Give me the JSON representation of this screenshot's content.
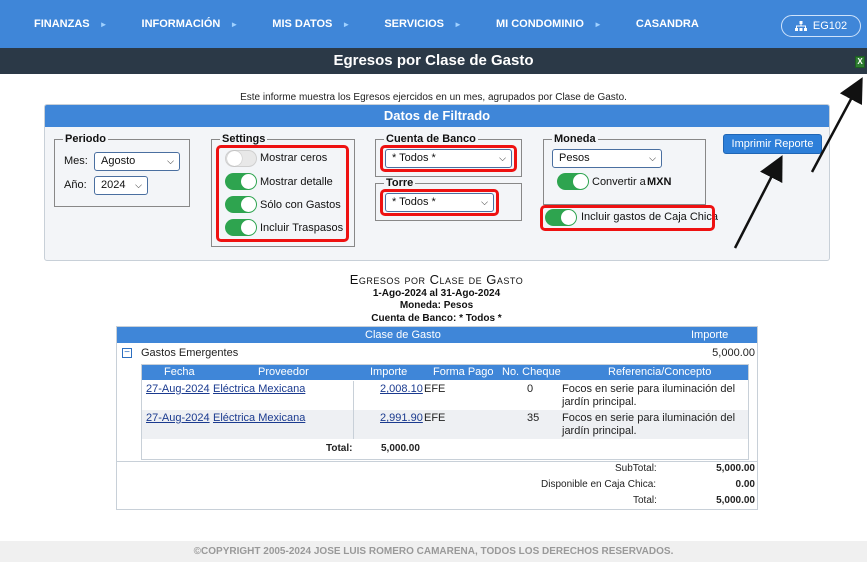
{
  "nav": {
    "items": [
      "FINANZAS",
      "INFORMACIÓN",
      "MIS DATOS",
      "SERVICIOS",
      "MI CONDOMINIO",
      "CASANDRA"
    ],
    "user_label": "EG102"
  },
  "page_title": "Egresos por Clase de Gasto",
  "intro_text": "Este informe muestra los Egresos ejercidos en un mes, agrupados por Clase de Gasto.",
  "filters": {
    "heading": "Datos de Filtrado",
    "periodo": {
      "legend": "Periodo",
      "mes_label": "Mes:",
      "mes_value": "Agosto",
      "anio_label": "Año:",
      "anio_value": "2024"
    },
    "settings": {
      "legend": "Settings",
      "toggles": [
        {
          "label": "Mostrar ceros",
          "on": false
        },
        {
          "label": "Mostrar detalle",
          "on": true
        },
        {
          "label": "Sólo con Gastos",
          "on": true
        },
        {
          "label": "Incluir Traspasos",
          "on": true
        }
      ]
    },
    "cuenta_banco": {
      "legend": "Cuenta de Banco",
      "value": "* Todos *"
    },
    "torre": {
      "legend": "Torre",
      "value": "* Todos *"
    },
    "moneda": {
      "legend": "Moneda",
      "value": "Pesos",
      "convertir_label": "Convertir a",
      "convertir_currency": "MXN",
      "caja_chica_label": "Incluir gastos de Caja Chica"
    },
    "print_label": "Imprimir Reporte"
  },
  "report": {
    "title": "Egresos por Clase de Gasto",
    "period": "1-Ago-2024 al 31-Ago-2024",
    "moneda_line": "Moneda: Pesos",
    "cuenta_line": "Cuenta de Banco: * Todos *",
    "col_clase": "Clase de Gasto",
    "col_importe": "Importe",
    "group": {
      "name": "Gastos Emergentes",
      "amount": "5,000.00"
    },
    "detail_headers": {
      "fecha": "Fecha",
      "proveedor": "Proveedor",
      "importe": "Importe",
      "forma_pago": "Forma Pago",
      "cheque": "No. Cheque",
      "referencia": "Referencia/Concepto"
    },
    "rows": [
      {
        "fecha": "27-Aug-2024",
        "proveedor": "Eléctrica Mexicana",
        "importe": "2,008.10",
        "forma_pago": "EFE",
        "cheque": "0",
        "ref1": "Focos en serie para iluminación del",
        "ref2": "jardín principal."
      },
      {
        "fecha": "27-Aug-2024",
        "proveedor": "Eléctrica Mexicana",
        "importe": "2,991.90",
        "forma_pago": "EFE",
        "cheque": "35",
        "ref1": "Focos en serie para iluminación del",
        "ref2": "jardín principal."
      }
    ],
    "detail_total_label": "Total:",
    "detail_total": "5,000.00",
    "subtotal_label": "SubTotal:",
    "subtotal": "5,000.00",
    "disponible_label": "Disponible en Caja Chica:",
    "disponible": "0.00",
    "total_label": "Total:",
    "total": "5,000.00"
  },
  "footer": "©COPYRIGHT 2005-2024 JOSE LUIS ROMERO CAMARENA, TODOS LOS DERECHOS RESERVADOS."
}
